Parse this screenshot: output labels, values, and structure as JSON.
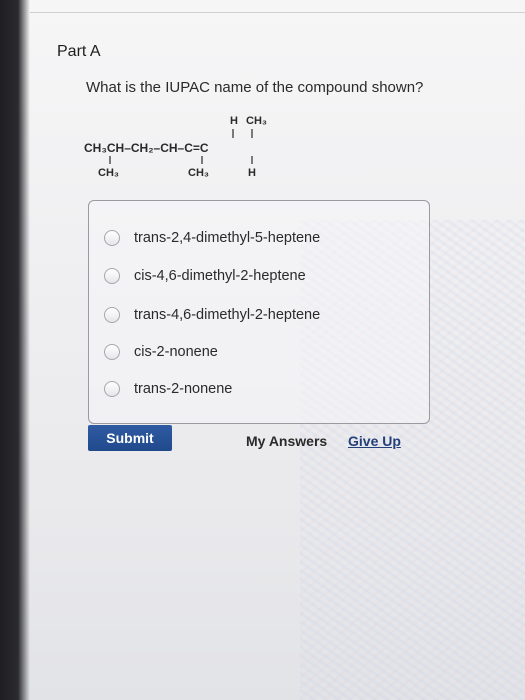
{
  "part": {
    "label": "Part A"
  },
  "question": {
    "text": "What is the IUPAC name of the compound shown?"
  },
  "structure": {
    "top_h": "H",
    "top_ch3": "CH₃",
    "main_chain": "CH₃CH–CH₂–CH–C=C",
    "bottom_ch3_1": "CH₃",
    "bottom_ch3_2": "CH₃",
    "bottom_h": "H"
  },
  "choices": [
    {
      "label": "trans-2,4-dimethyl-5-heptene",
      "selected": false
    },
    {
      "label": "cis-4,6-dimethyl-2-heptene",
      "selected": false
    },
    {
      "label": "trans-4,6-dimethyl-2-heptene",
      "selected": false
    },
    {
      "label": "cis-2-nonene",
      "selected": false
    },
    {
      "label": "trans-2-nonene",
      "selected": false
    }
  ],
  "actions": {
    "submit_label": "Submit",
    "my_answers_label": "My Answers",
    "give_up_label": "Give Up"
  },
  "colors": {
    "submit_bg": "#214a8c",
    "link": "#24407a",
    "text": "#2a2a2a"
  }
}
